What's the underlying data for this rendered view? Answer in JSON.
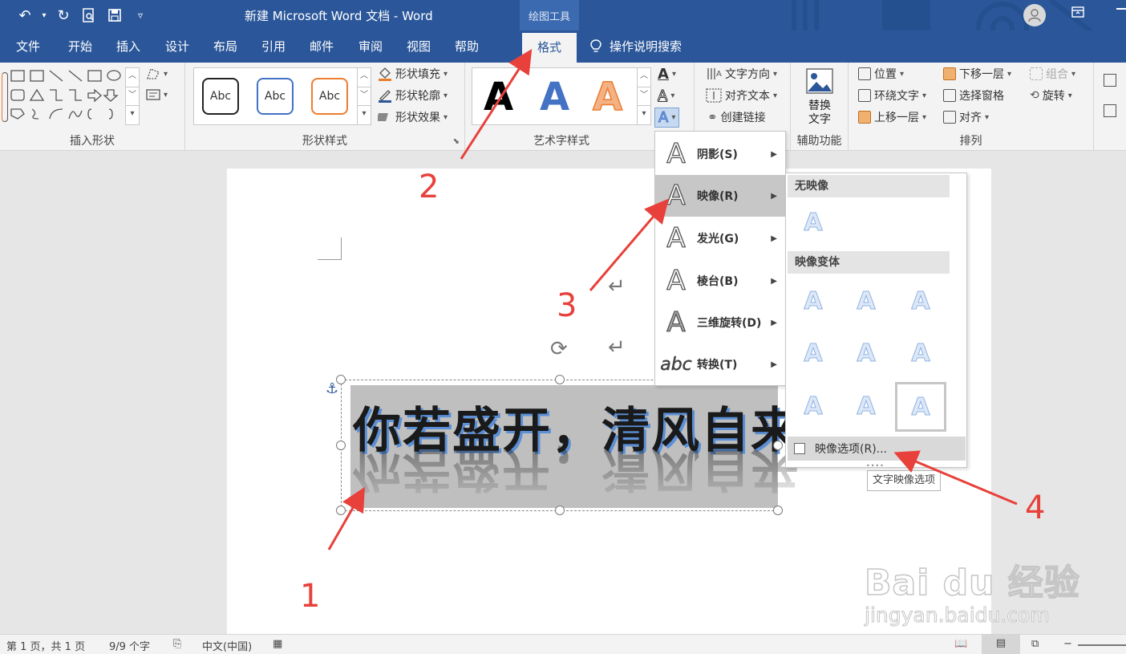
{
  "title": {
    "document": "新建 Microsoft Word 文档 - Word",
    "tools_label": "绘图工具"
  },
  "tabs": [
    "文件",
    "开始",
    "插入",
    "设计",
    "布局",
    "引用",
    "邮件",
    "审阅",
    "视图",
    "帮助",
    "格式"
  ],
  "tell_me": "操作说明搜索",
  "ribbon": {
    "groups": {
      "insert_shapes": "插入形状",
      "shape_styles": "形状样式",
      "wordart_styles": "艺术字样式",
      "accessibility": "辅助功能",
      "arrange": "排列"
    },
    "shape_fill": "形状填充",
    "shape_outline": "形状轮廓",
    "shape_effects": "形状效果",
    "style_sample": "Abc",
    "wordart_sample": "A",
    "text_direction": "文字方向",
    "align_text": "对齐文本",
    "create_link": "创建链接",
    "alt_text_1": "替换",
    "alt_text_2": "文字",
    "position": "位置",
    "wrap_text": "环绕文字",
    "bring_forward": "上移一层",
    "send_backward": "下移一层",
    "selection_pane": "选择窗格",
    "align": "对齐",
    "group": "组合",
    "rotate": "旋转"
  },
  "document": {
    "text": "你若盛开，清风自来"
  },
  "effects_menu": {
    "items": [
      {
        "label": "阴影(S)",
        "icon": "A"
      },
      {
        "label": "映像(R)",
        "icon": "A"
      },
      {
        "label": "发光(G)",
        "icon": "A"
      },
      {
        "label": "棱台(B)",
        "icon": "A"
      },
      {
        "label": "三维旋转(D)",
        "icon": "A"
      },
      {
        "label": "转换(T)",
        "icon": "abc"
      }
    ]
  },
  "reflection_submenu": {
    "no_reflection": "无映像",
    "variations": "映像变体",
    "options": "映像选项(R)...",
    "tooltip": "文字映像选项",
    "glyph": "A"
  },
  "annotations": [
    "1",
    "2",
    "3",
    "4"
  ],
  "watermark": {
    "line1": "Bai du 经验",
    "line2": "jingyan.baidu.com"
  },
  "statusbar": {
    "page": "第 1 页，共 1 页",
    "words": "9/9 个字",
    "language": "中文(中国)"
  },
  "colors": {
    "word_blue": "#2b579a",
    "annotation_red": "#e8403a",
    "reflection_blue": "#8fb2e3"
  }
}
